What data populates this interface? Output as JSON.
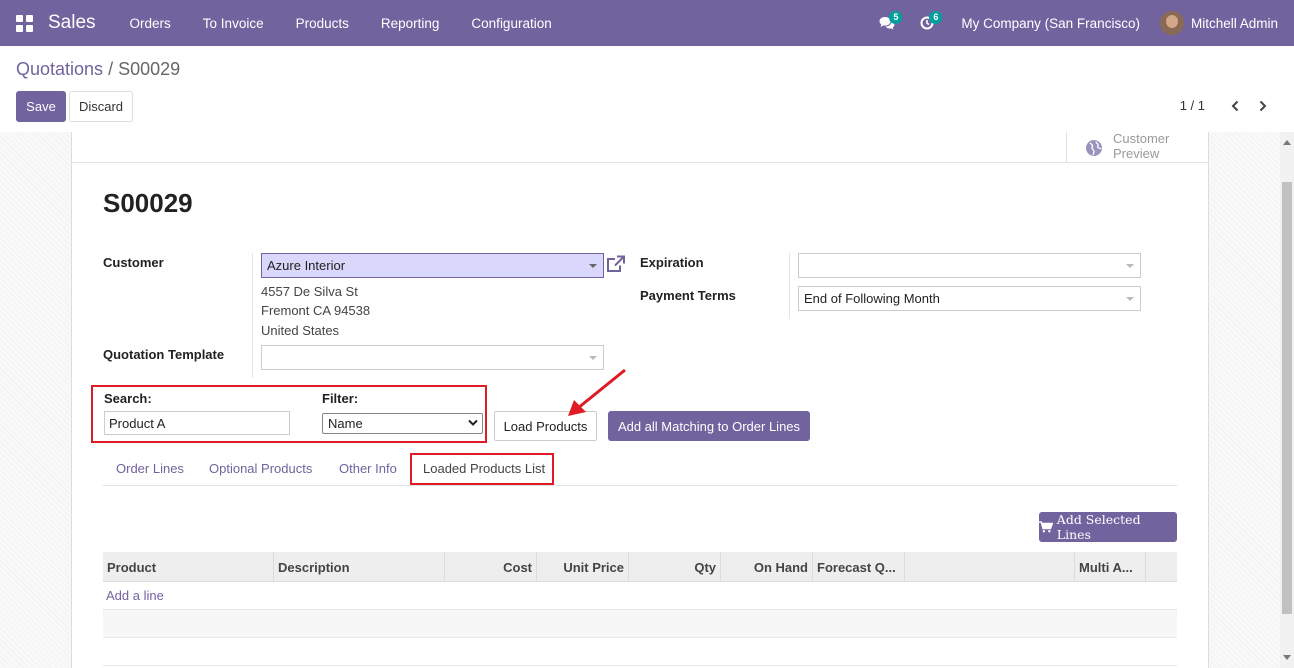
{
  "navbar": {
    "app_name": "Sales",
    "menu": [
      "Orders",
      "To Invoice",
      "Products",
      "Reporting",
      "Configuration"
    ],
    "messages_count": "5",
    "activities_count": "6",
    "company": "My Company (San Francisco)",
    "user": "Mitchell Admin"
  },
  "breadcrumb": {
    "parent": "Quotations",
    "separator": "/",
    "current": "S00029"
  },
  "actions": {
    "save": "Save",
    "discard": "Discard"
  },
  "pager": {
    "value": "1 / 1"
  },
  "button_box": {
    "customer_preview_line1": "Customer",
    "customer_preview_line2": "Preview"
  },
  "record": {
    "name": "S00029",
    "customer_label": "Customer",
    "customer_value": "Azure Interior",
    "address_line1": "4557 De Silva St",
    "address_line2": "Fremont CA 94538",
    "address_line3": "United States",
    "quotation_template_label": "Quotation Template",
    "quotation_template_value": "",
    "expiration_label": "Expiration",
    "expiration_value": "",
    "payment_terms_label": "Payment Terms",
    "payment_terms_value": "End of Following Month"
  },
  "loader": {
    "search_label": "Search:",
    "search_value": "Product A",
    "filter_label": "Filter:",
    "filter_value": "Name",
    "load_button": "Load Products",
    "add_all_button": "Add all Matching to Order Lines"
  },
  "tabs": [
    "Order Lines",
    "Optional Products",
    "Other Info",
    "Loaded Products List"
  ],
  "loaded_list": {
    "add_selected_button": "Add Selected Lines",
    "columns": [
      "Product",
      "Description",
      "Cost",
      "Unit Price",
      "Qty",
      "On Hand",
      "Forecast Q...",
      "",
      "Multi A..."
    ],
    "add_line": "Add a line"
  },
  "colors": {
    "brand": "#71639e",
    "highlight": "#e01b24"
  }
}
